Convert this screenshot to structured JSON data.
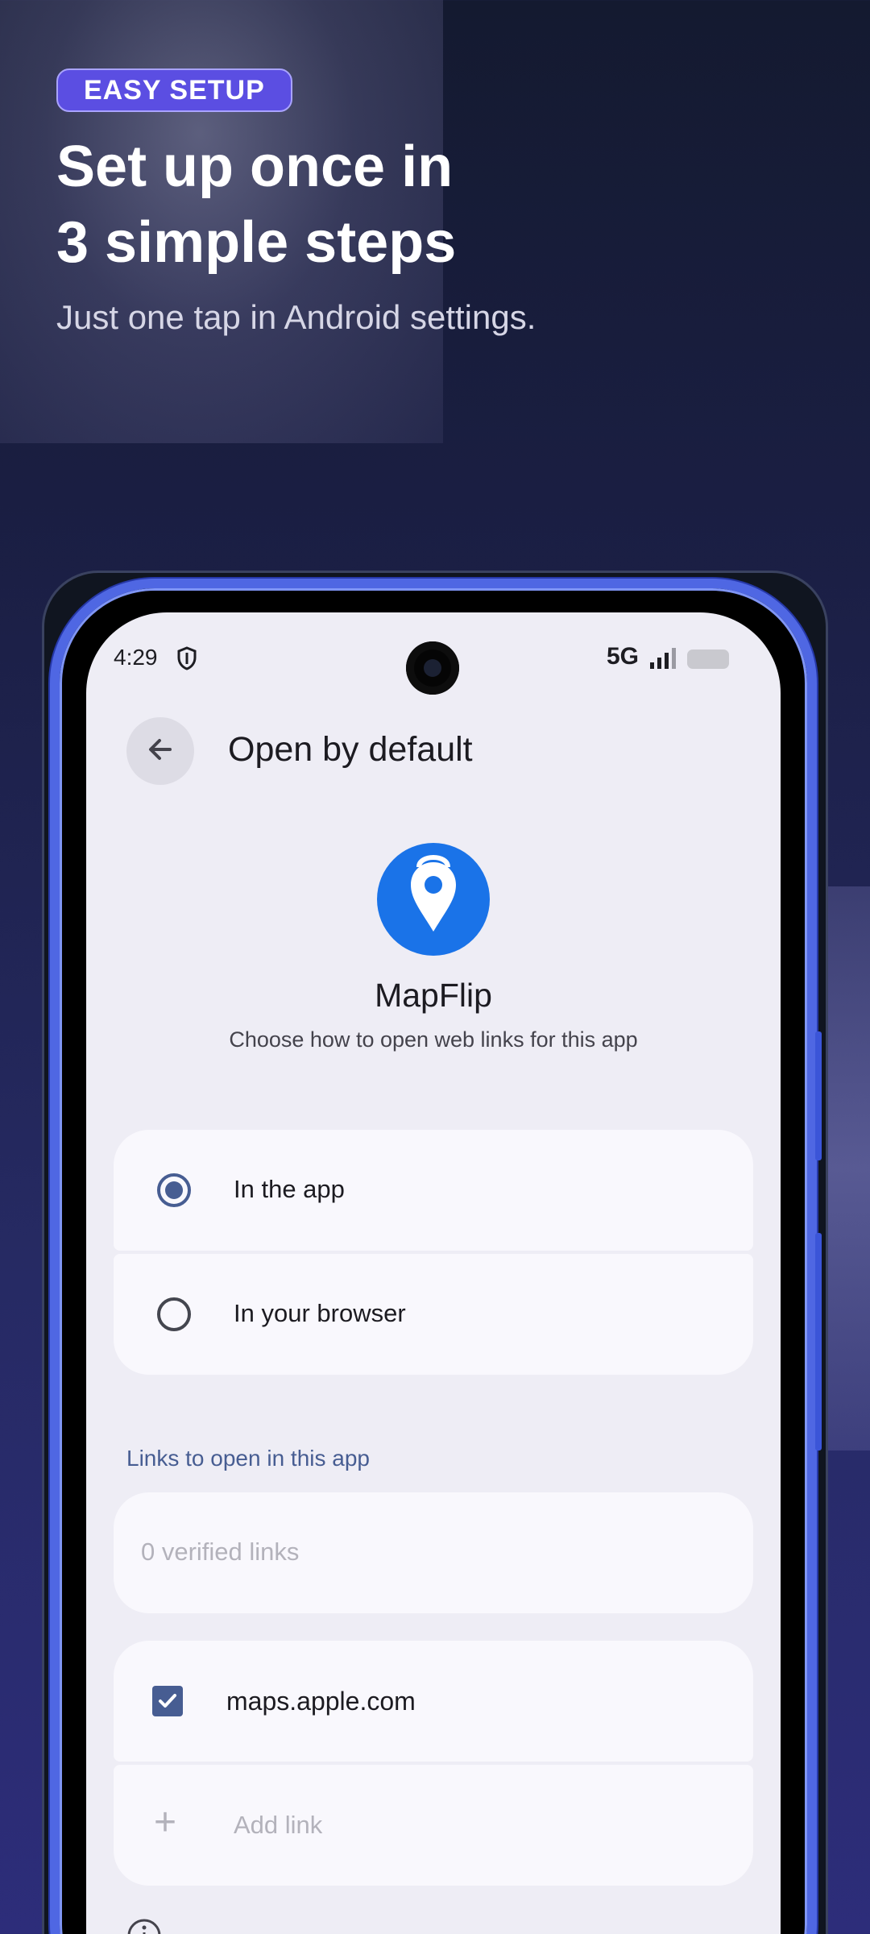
{
  "promo": {
    "badge": "EASY SETUP",
    "headline_line1": "Set up once in",
    "headline_line2": "3 simple steps",
    "subhead": "Just one tap in Android settings."
  },
  "status_bar": {
    "time": "4:29",
    "network": "5G",
    "icons": [
      "shield-icon",
      "signal-icon",
      "battery-icon"
    ]
  },
  "header": {
    "title": "Open by default",
    "back_icon": "arrow-left-icon"
  },
  "app": {
    "name": "MapFlip",
    "description": "Choose how to open web links for this app",
    "icon": "map-pin-icon"
  },
  "open_options": [
    {
      "label": "In the app",
      "selected": true
    },
    {
      "label": "In your browser",
      "selected": false
    }
  ],
  "links": {
    "section_label": "Links to open in this app",
    "verified": "0 verified links",
    "items": [
      {
        "domain": "maps.apple.com",
        "checked": true
      }
    ],
    "add_label": "Add link"
  },
  "colors": {
    "accent": "#475d92",
    "badge": "#5b4ee2",
    "frame": "#4f67e3",
    "app_icon": "#1a73e8"
  }
}
